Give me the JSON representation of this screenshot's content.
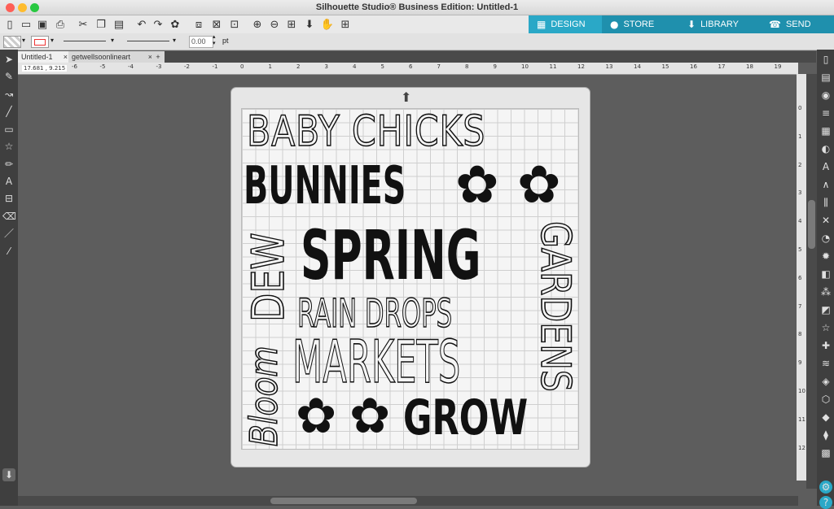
{
  "window": {
    "title": "Silhouette Studio® Business Edition: Untitled-1"
  },
  "toolbar": {
    "icons": [
      "new-icon",
      "open-icon",
      "save-icon",
      "print-icon",
      "cut-icon",
      "copy-icon",
      "paste-icon",
      "undo-icon",
      "redo-icon",
      "replicate-icon",
      "group-icon",
      "ungroup-icon",
      "zoom-in-icon",
      "zoom-out-icon",
      "zoom-fit-icon",
      "move-icon",
      "pan-icon",
      "add-page-icon"
    ]
  },
  "modes": [
    {
      "label": "DESIGN",
      "icon": "grid-icon",
      "color": "#2aa8c7"
    },
    {
      "label": "STORE",
      "icon": "store-icon",
      "color": "#1f90ad"
    },
    {
      "label": "LIBRARY",
      "icon": "library-icon",
      "color": "#1f90ad"
    },
    {
      "label": "SEND",
      "icon": "send-icon",
      "color": "#1f90ad"
    }
  ],
  "props": {
    "line_width": "0.00",
    "unit": "pt"
  },
  "tabs": [
    {
      "label": "Untitled-1",
      "close": "×"
    },
    {
      "label": "getwellsoonlineart",
      "close": "×"
    },
    {
      "label": "+"
    }
  ],
  "ruler": {
    "coords": "17.681 , 9.215",
    "h_ticks": [
      "-6",
      "-5",
      "-4",
      "-3",
      "-2",
      "-1",
      "0",
      "1",
      "2",
      "3",
      "4",
      "5",
      "6",
      "7",
      "8",
      "9",
      "10",
      "11",
      "12",
      "13",
      "14",
      "15",
      "16",
      "17",
      "18",
      "19"
    ],
    "v_ticks": [
      "0",
      "1",
      "2",
      "3",
      "4",
      "5",
      "6",
      "7",
      "8",
      "9",
      "10",
      "11",
      "12"
    ]
  },
  "design": {
    "words": [
      {
        "text": "BABY CHICKS",
        "style": "outline"
      },
      {
        "text": "BUNNIES",
        "style": "solid"
      },
      {
        "text": "DEW",
        "style": "outline"
      },
      {
        "text": "SPRING",
        "style": "solid"
      },
      {
        "text": "GARDENS",
        "style": "outline"
      },
      {
        "text": "RAIN DROPS",
        "style": "outline"
      },
      {
        "text": "Bloom",
        "style": "outline"
      },
      {
        "text": "MARKETS",
        "style": "outline"
      },
      {
        "text": "GROW",
        "style": "solid"
      }
    ]
  },
  "colors": {
    "accent": "#2aa8c7",
    "mat": "#e6e6e6",
    "workspace": "#5d5d5d"
  }
}
